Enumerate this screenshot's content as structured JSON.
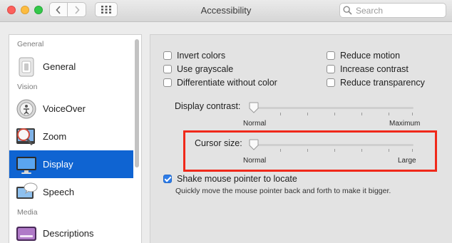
{
  "window": {
    "title": "Accessibility"
  },
  "search": {
    "placeholder": "Search"
  },
  "sidebar": {
    "sections": [
      {
        "label": "General"
      },
      {
        "label": "Vision"
      },
      {
        "label": "Media"
      }
    ],
    "items": [
      {
        "label": "General",
        "icon": "general-icon"
      },
      {
        "label": "VoiceOver",
        "icon": "voiceover-icon"
      },
      {
        "label": "Zoom",
        "icon": "zoom-icon"
      },
      {
        "label": "Display",
        "icon": "display-icon",
        "selected": true
      },
      {
        "label": "Speech",
        "icon": "speech-icon"
      },
      {
        "label": "Descriptions",
        "icon": "descriptions-icon"
      }
    ]
  },
  "options": {
    "left": [
      {
        "label": "Invert colors",
        "checked": false
      },
      {
        "label": "Use grayscale",
        "checked": false
      },
      {
        "label": "Differentiate without color",
        "checked": false
      }
    ],
    "right": [
      {
        "label": "Reduce motion",
        "checked": false
      },
      {
        "label": "Increase contrast",
        "checked": false
      },
      {
        "label": "Reduce transparency",
        "checked": false
      }
    ]
  },
  "display_contrast": {
    "label": "Display contrast:",
    "min_label": "Normal",
    "max_label": "Maximum",
    "value": 0
  },
  "cursor_size": {
    "label": "Cursor size:",
    "min_label": "Normal",
    "max_label": "Large",
    "value": 0
  },
  "shake": {
    "label": "Shake mouse pointer to locate",
    "checked": true,
    "description": "Quickly move the mouse pointer back and forth to make it bigger."
  },
  "colors": {
    "selection": "#0f64d2",
    "highlight_box": "#f0291a",
    "checkbox_checked": "#2e7de9"
  }
}
